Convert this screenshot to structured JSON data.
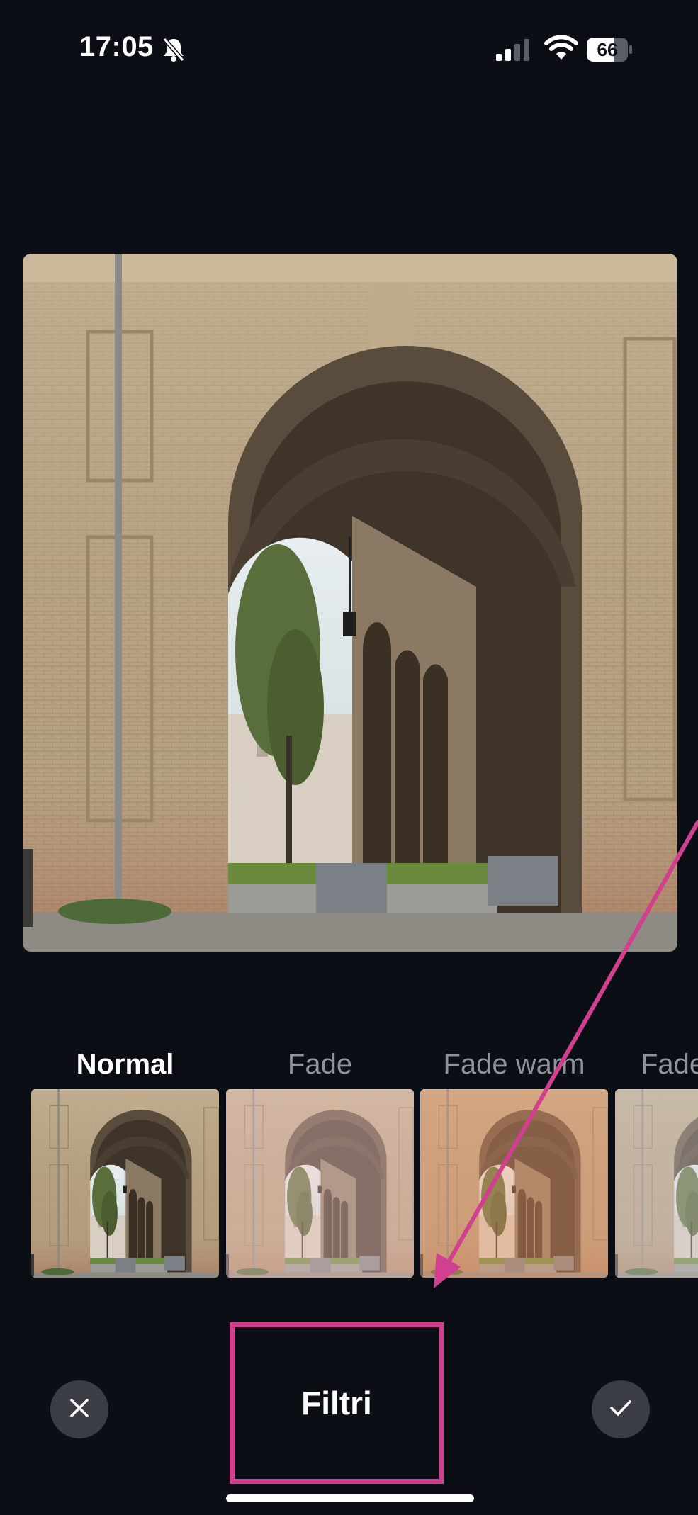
{
  "status_bar": {
    "time": "17:05",
    "battery_percent": "66",
    "battery_level": 0.66,
    "icons": [
      "bell-slash-icon",
      "cellular-signal-icon",
      "wifi-icon",
      "battery-icon"
    ]
  },
  "filters": [
    {
      "label": "Normal",
      "selected": true,
      "tint": "none"
    },
    {
      "label": "Fade",
      "selected": false,
      "tint": "#f0c8c0"
    },
    {
      "label": "Fade warm",
      "selected": false,
      "tint": "#f3a070"
    },
    {
      "label": "Fade",
      "selected": false,
      "tint": "#d8d0d0"
    }
  ],
  "bottom_bar": {
    "title": "Filtri",
    "cancel_icon": "close-icon",
    "confirm_icon": "checkmark-icon"
  },
  "annotation": {
    "color": "#d0408f"
  }
}
